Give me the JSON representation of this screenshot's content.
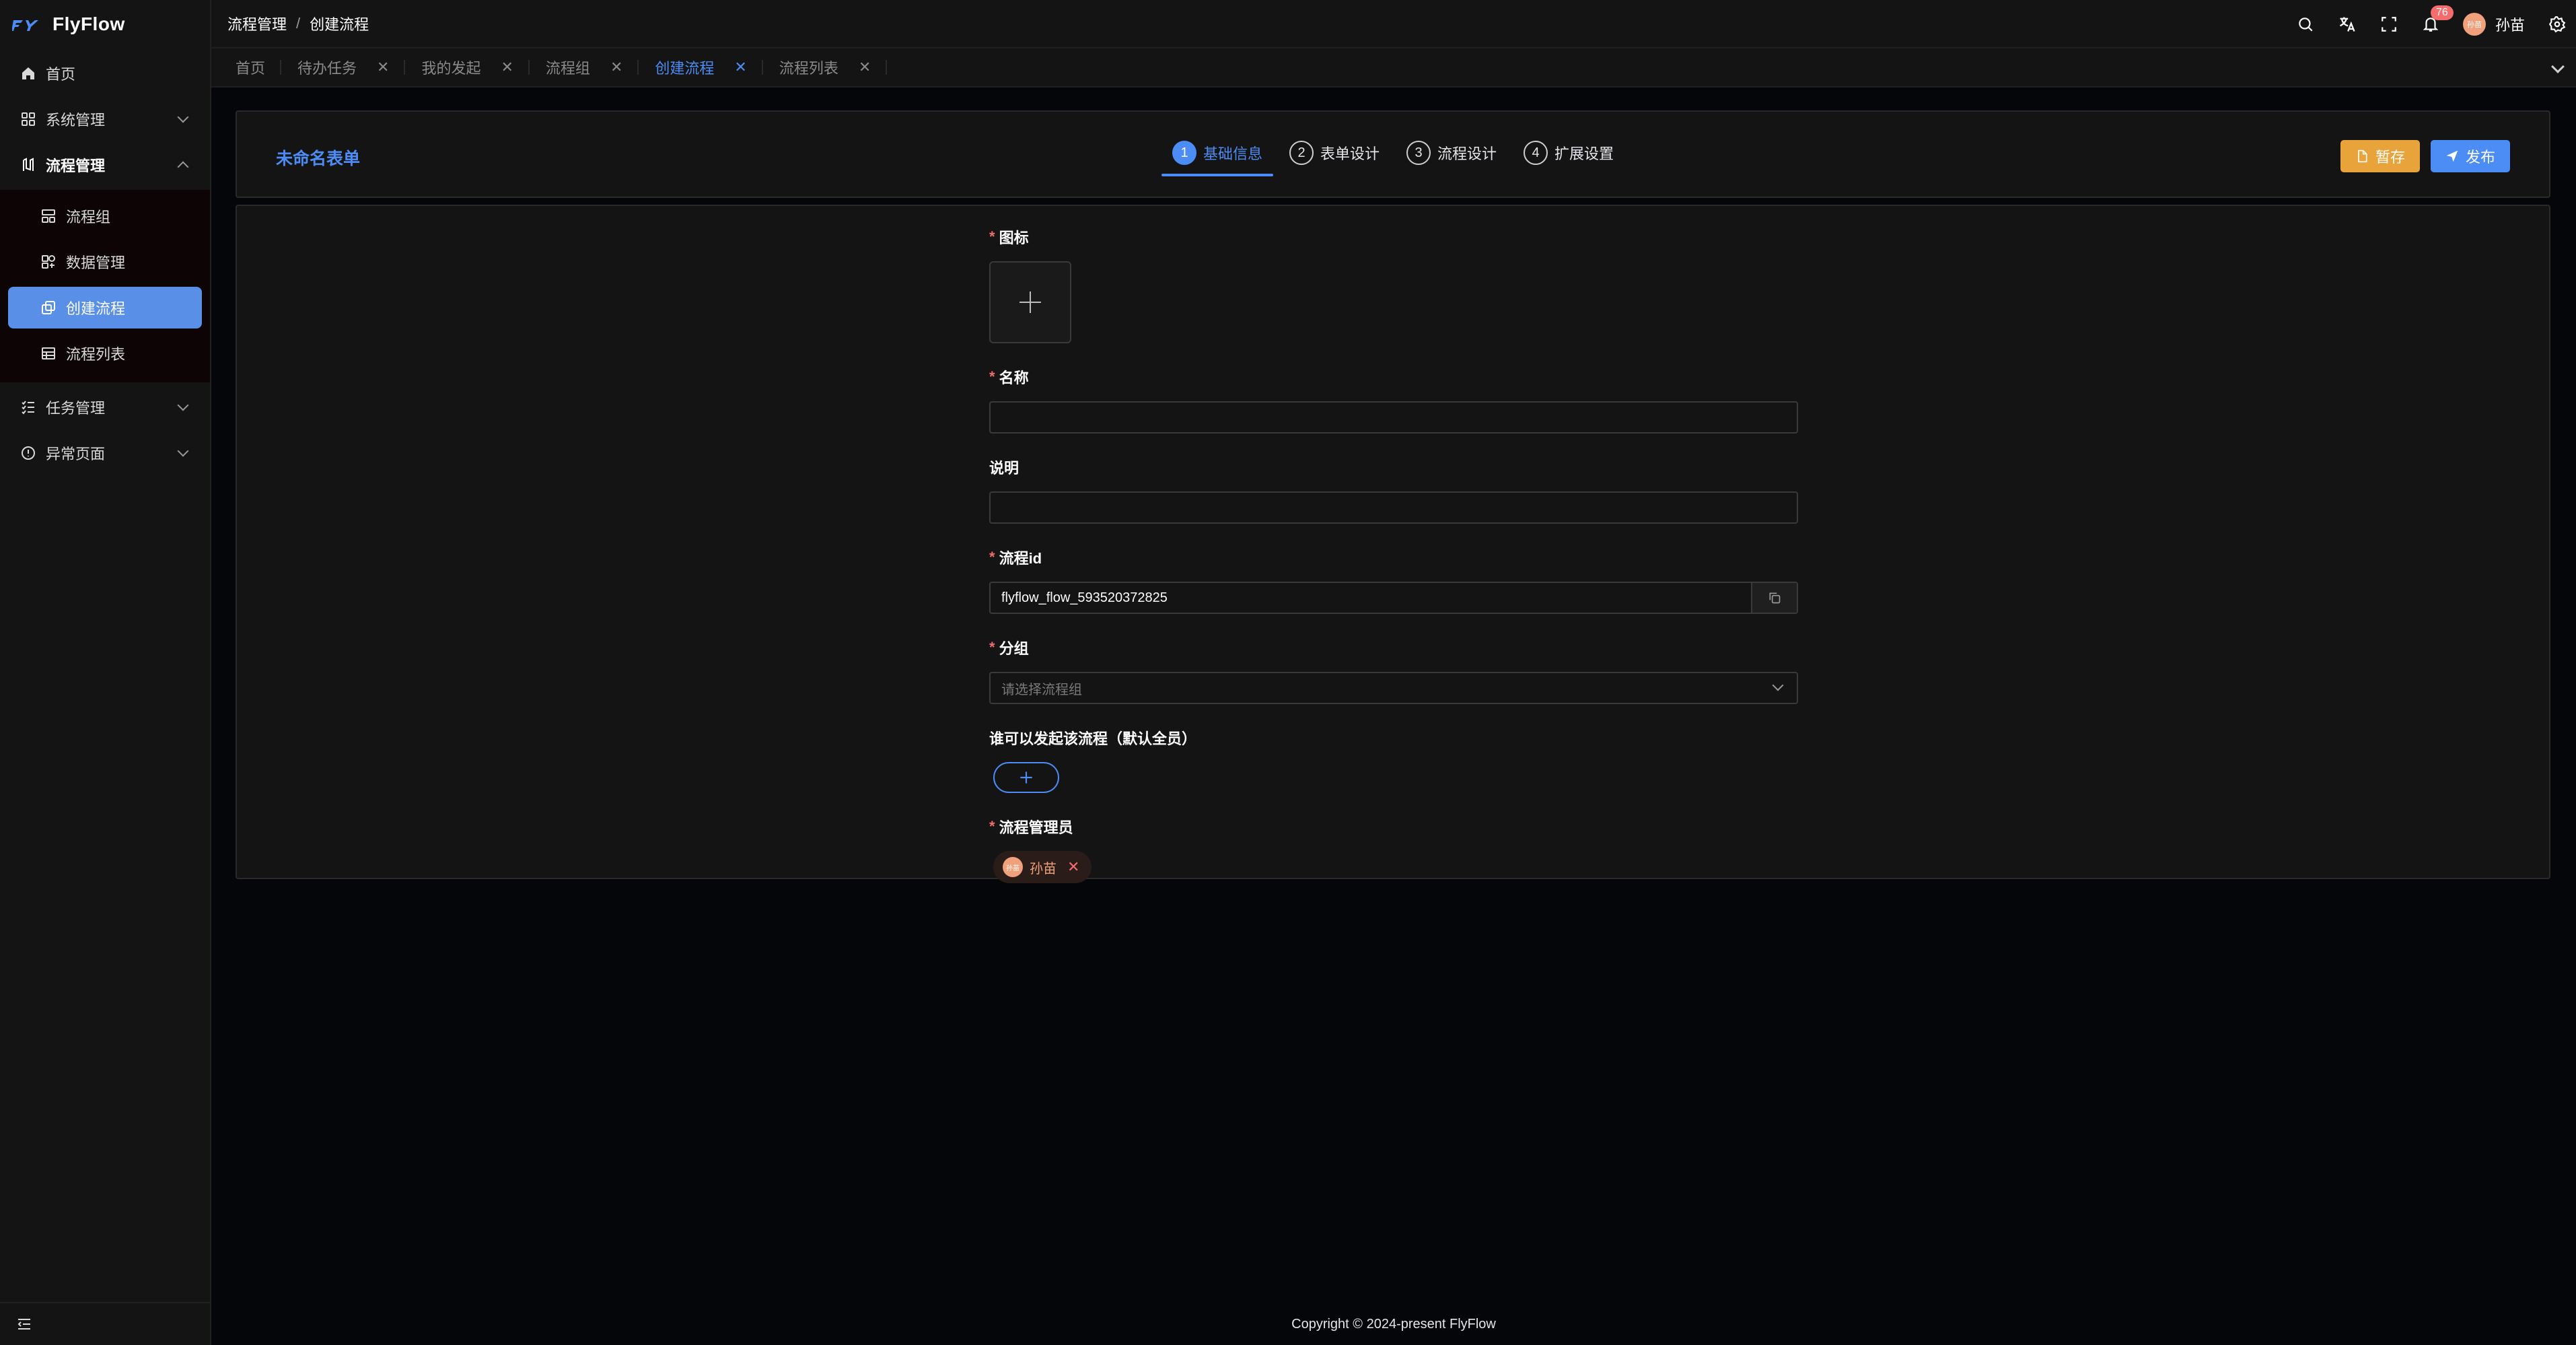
{
  "app": {
    "name": "FlyFlow"
  },
  "sidebar": {
    "items": [
      {
        "label": "首页",
        "icon": "home-icon"
      },
      {
        "label": "系统管理",
        "icon": "grid-icon"
      },
      {
        "label": "流程管理",
        "icon": "flow-icon"
      },
      {
        "label": "任务管理",
        "icon": "list-check-icon"
      },
      {
        "label": "异常页面",
        "icon": "alert-circle-icon"
      }
    ],
    "submenu": [
      {
        "label": "流程组",
        "icon": "group-icon"
      },
      {
        "label": "数据管理",
        "icon": "data-icon"
      },
      {
        "label": "创建流程",
        "icon": "create-icon",
        "active": true
      },
      {
        "label": "流程列表",
        "icon": "table-icon"
      }
    ]
  },
  "header": {
    "breadcrumb": [
      "流程管理",
      "创建流程"
    ],
    "notification_count": "76",
    "user_name": "孙苗",
    "avatar_text": "孙苗"
  },
  "tabs": [
    {
      "label": "首页",
      "closable": false
    },
    {
      "label": "待办任务",
      "closable": true
    },
    {
      "label": "我的发起",
      "closable": true
    },
    {
      "label": "流程组",
      "closable": true
    },
    {
      "label": "创建流程",
      "closable": true,
      "active": true
    },
    {
      "label": "流程列表",
      "closable": true
    }
  ],
  "toolbar": {
    "form_title": "未命名表单",
    "steps": [
      {
        "num": "1",
        "label": "基础信息",
        "active": true
      },
      {
        "num": "2",
        "label": "表单设计"
      },
      {
        "num": "3",
        "label": "流程设计"
      },
      {
        "num": "4",
        "label": "扩展设置"
      }
    ],
    "save_label": "暂存",
    "publish_label": "发布"
  },
  "form": {
    "icon_label": "图标",
    "name_label": "名称",
    "name_value": "",
    "desc_label": "说明",
    "desc_value": "",
    "flow_id_label": "流程id",
    "flow_id_value": "flyflow_flow_593520372825",
    "group_label": "分组",
    "group_placeholder": "请选择流程组",
    "starter_label": "谁可以发起该流程（默认全员）",
    "admin_label": "流程管理员",
    "admin_user": "孙苗",
    "admin_avatar_text": "孙苗"
  },
  "footer": {
    "copyright": "Copyright © 2024-present FlyFlow"
  },
  "colors": {
    "accent": "#4c8cf5",
    "warning": "#e8a33a",
    "danger": "#f56c6c"
  }
}
